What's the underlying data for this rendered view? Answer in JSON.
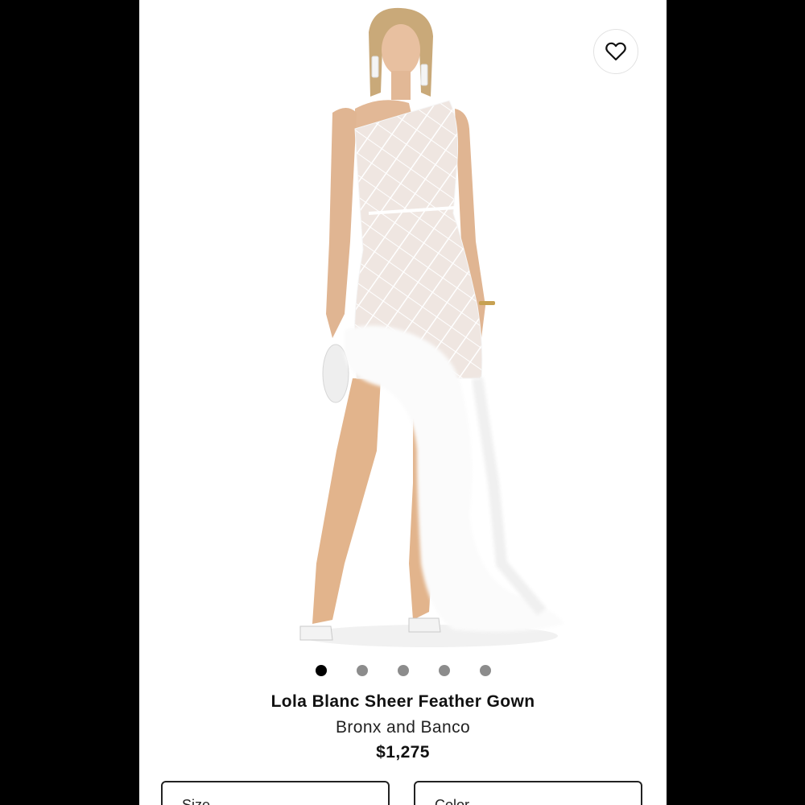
{
  "product": {
    "title": "Lola Blanc Sheer Feather Gown",
    "brand": "Bronx and Banco",
    "price": "$1,275"
  },
  "gallery": {
    "image_count": 5,
    "active_index": 0
  },
  "favorite": {
    "icon": "heart-outline-icon"
  },
  "selectors": {
    "size_label": "Size",
    "color_label": "Color"
  },
  "colors": {
    "background": "#000000",
    "panel": "#ffffff",
    "dot_active": "#000000",
    "dot_inactive": "#8c8c8c"
  }
}
